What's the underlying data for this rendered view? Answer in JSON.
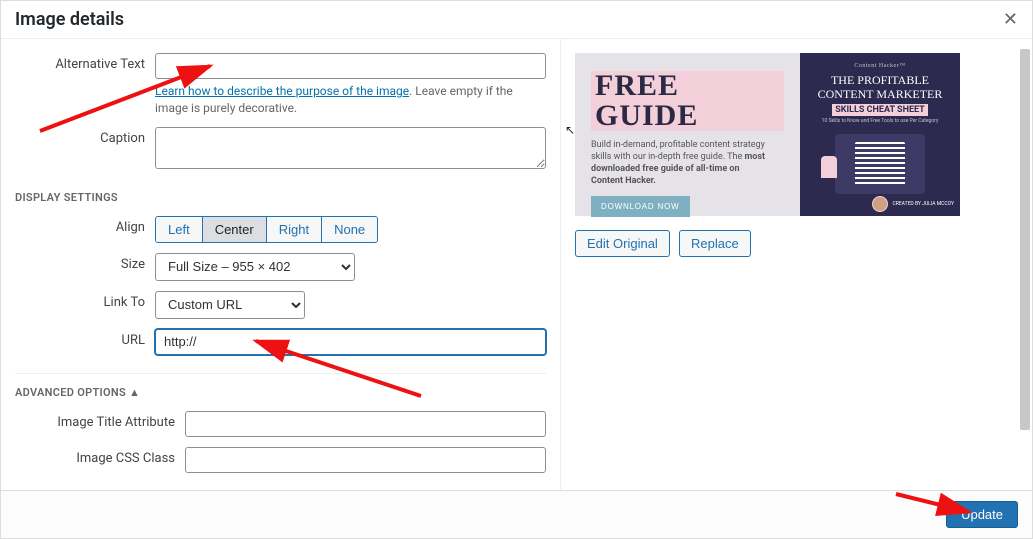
{
  "modal": {
    "title": "Image details",
    "close_label": "Close"
  },
  "alt": {
    "label": "Alternative Text",
    "value": "",
    "help_link_text": "Learn how to describe the purpose of the image",
    "help_suffix": ". Leave empty if the image is purely decorative."
  },
  "caption": {
    "label": "Caption",
    "value": ""
  },
  "display_settings_header": "DISPLAY SETTINGS",
  "align": {
    "label": "Align",
    "options": [
      "Left",
      "Center",
      "Right",
      "None"
    ],
    "selected": "Center"
  },
  "size": {
    "label": "Size",
    "selected": "Full Size – 955 × 402"
  },
  "link_to": {
    "label": "Link To",
    "selected": "Custom URL"
  },
  "url": {
    "label": "URL",
    "value": "http://"
  },
  "advanced_header": "ADVANCED OPTIONS",
  "title_attr": {
    "label": "Image Title Attribute",
    "value": ""
  },
  "css_class": {
    "label": "Image CSS Class",
    "value": ""
  },
  "preview": {
    "brand": "FREE GUIDE",
    "sub1": "Build in-demand, profitable content strategy skills with our in-depth free guide. The ",
    "sub_bold": "most downloaded free guide of all-time on Content Hacker.",
    "cta": "DOWNLOAD NOW",
    "ph_top": "Content Hacker™",
    "ph_line1": "THE PROFITABLE",
    "ph_line2": "CONTENT MARKETER",
    "ph_bar": "SKILLS CHEAT SHEET",
    "ph_tiny": "10 Skills to Know and Free Tools to use Per Category",
    "avatar_text": "CREATED BY\nJULIA MCCOY"
  },
  "actions": {
    "edit": "Edit Original",
    "replace": "Replace"
  },
  "footer": {
    "update": "Update"
  }
}
